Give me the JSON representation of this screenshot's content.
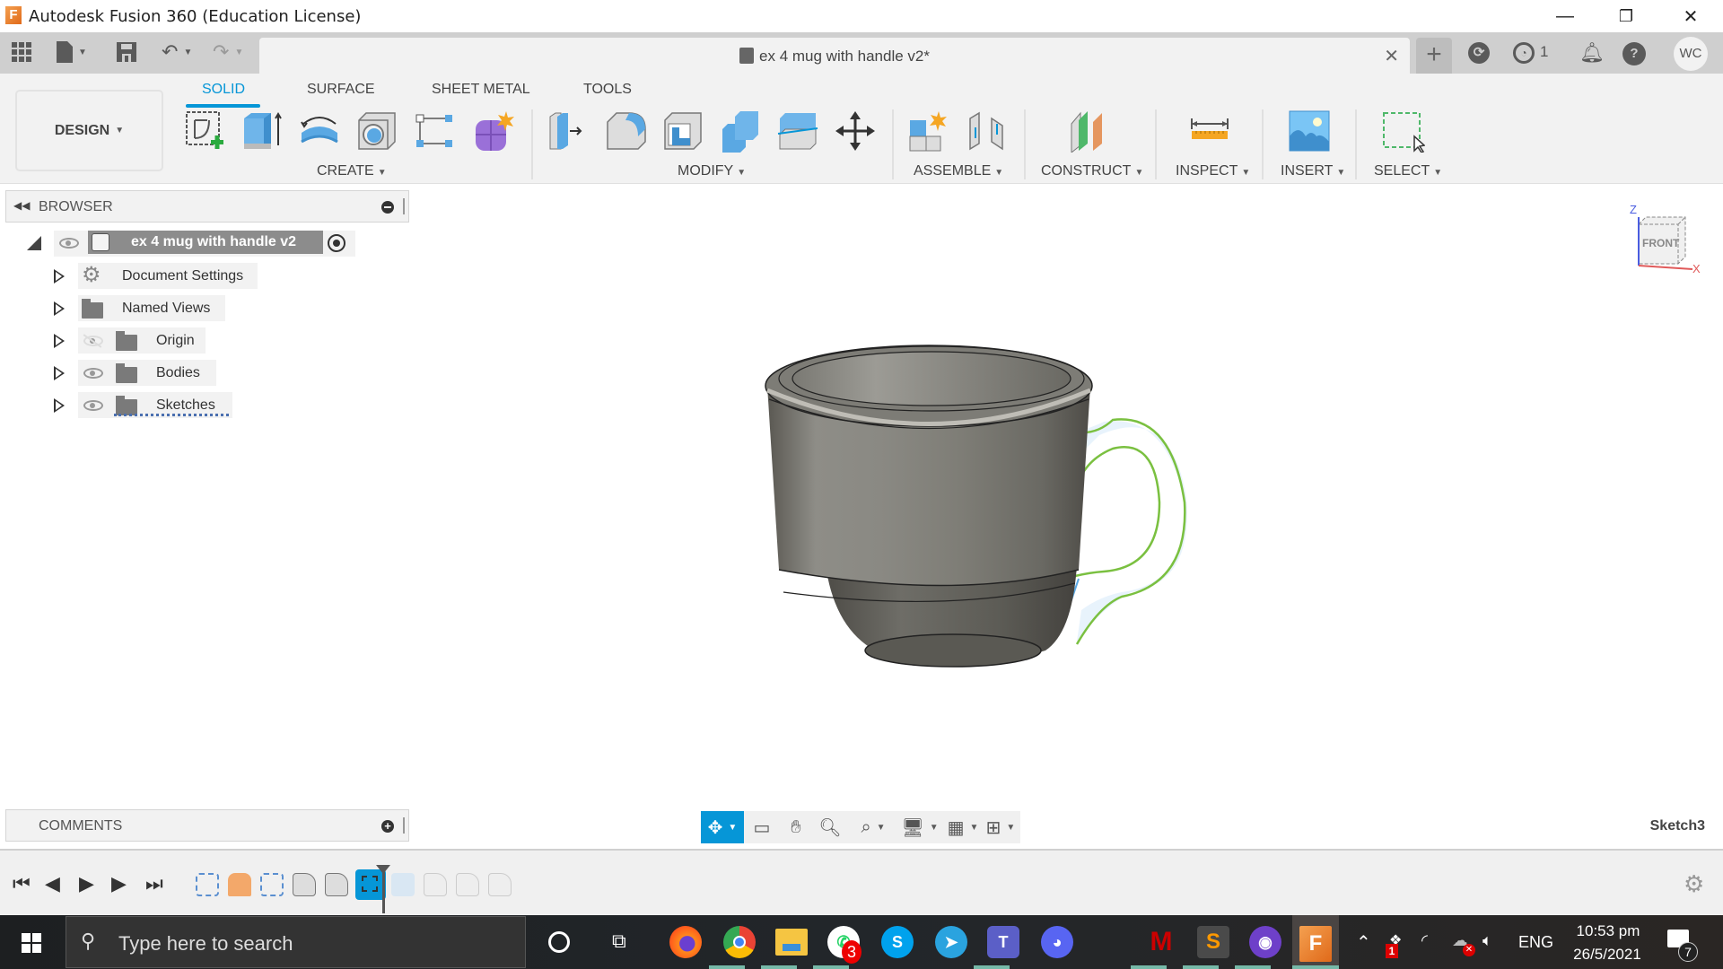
{
  "window": {
    "title": "Autodesk Fusion 360 (Education License)",
    "app_logo": "F",
    "controls": {
      "minimize": "—",
      "restore": "❐",
      "close": "✕"
    }
  },
  "appbar": {
    "document_tab": {
      "title": "ex 4 mug with handle v2*",
      "close": "✕"
    },
    "new_tab": "+",
    "job_status_count": "1",
    "user_initials": "WC"
  },
  "ribbon": {
    "workspace": "DESIGN",
    "tabs": [
      {
        "label": "SOLID",
        "active": true
      },
      {
        "label": "SURFACE",
        "active": false
      },
      {
        "label": "SHEET METAL",
        "active": false
      },
      {
        "label": "TOOLS",
        "active": false
      }
    ],
    "groups": {
      "create": "CREATE",
      "modify": "MODIFY",
      "assemble": "ASSEMBLE",
      "construct": "CONSTRUCT",
      "inspect": "INSPECT",
      "insert": "INSERT",
      "select": "SELECT"
    },
    "accent_color": "#0696d7"
  },
  "browser": {
    "title": "BROWSER",
    "root": "ex 4 mug with handle v2",
    "items": [
      {
        "label": "Document Settings",
        "icon": "gear-icon"
      },
      {
        "label": "Named Views",
        "icon": "folder-icon"
      },
      {
        "label": "Origin",
        "icon": "folder-icon",
        "visible": false
      },
      {
        "label": "Bodies",
        "icon": "folder-icon",
        "visible": true
      },
      {
        "label": "Sketches",
        "icon": "folder-icon",
        "visible": true
      }
    ]
  },
  "viewcube": {
    "face": "FRONT",
    "axis_z": "Z",
    "axis_x": "X"
  },
  "comments": {
    "title": "COMMENTS"
  },
  "status": {
    "active_sketch": "Sketch3"
  },
  "taskbar": {
    "search_placeholder": "Type here to search",
    "whatsapp_badge": "3",
    "dropbox_badge": "1",
    "language": "ENG",
    "time": "10:53 pm",
    "date": "26/5/2021",
    "notifications": "7"
  }
}
